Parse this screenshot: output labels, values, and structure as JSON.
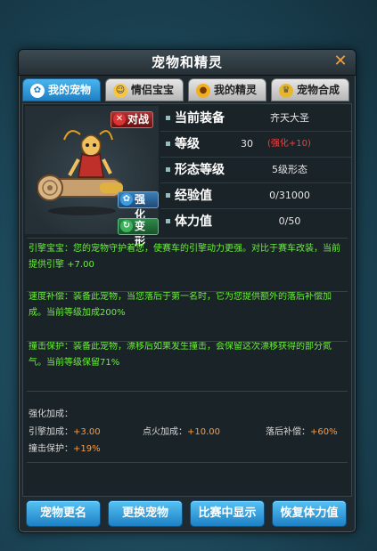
{
  "window": {
    "title": "宠物和精灵"
  },
  "tabs": [
    {
      "label": "我的宠物",
      "icon": "paw-icon",
      "active": true
    },
    {
      "label": "情侣宝宝",
      "icon": "baby-face-icon",
      "active": false
    },
    {
      "label": "我的精灵",
      "icon": "spirit-icon",
      "active": false
    },
    {
      "label": "宠物合成",
      "icon": "synthesis-icon",
      "active": false
    }
  ],
  "pet": {
    "badge_battle": "对战",
    "badge_enhance": "强化",
    "badge_transform": "变形"
  },
  "stats": {
    "equip_label": "当前装备",
    "equip_value": "齐天大圣",
    "level_label": "等级",
    "level_value": "30",
    "level_bonus": "(强化+10)",
    "form_label": "形态等级",
    "form_value": "5级形态",
    "exp_label": "经验值",
    "exp_value": "0/31000",
    "stamina_label": "体力值",
    "stamina_value": "0/50"
  },
  "skills": [
    {
      "text": "引擎宝宝：您的宠物守护着您，使赛车的引擎动力更强。对比于赛车改装，当前提供引擎 +7.00"
    },
    {
      "text": "速度补偿：装备此宠物，当您落后于第一名时，它为您提供额外的落后补偿加成。当前等级加成200%"
    },
    {
      "text": "撞击保护：装备此宠物，漂移后如果发生撞击，会保留这次漂移获得的部分氮气。当前等级保留71%"
    }
  ],
  "bonus": {
    "title": "强化加成：",
    "engine_label": "引擎加成：",
    "engine_value": "+3.00",
    "ignite_label": "点火加成：",
    "ignite_value": "+10.00",
    "lag_label": "落后补偿：",
    "lag_value": "+60%",
    "impact_label": "撞击保护：",
    "impact_value": "+19%"
  },
  "buttons": {
    "rename": "宠物更名",
    "replace": "更换宠物",
    "show_in_race": "比赛中显示",
    "restore_stamina": "恢复体力值"
  },
  "colors": {
    "accent": "#2a95d8",
    "skill_text": "#6bf03a",
    "bonus_value": "#ff9a3c",
    "level_bonus": "#ff3b3b"
  }
}
